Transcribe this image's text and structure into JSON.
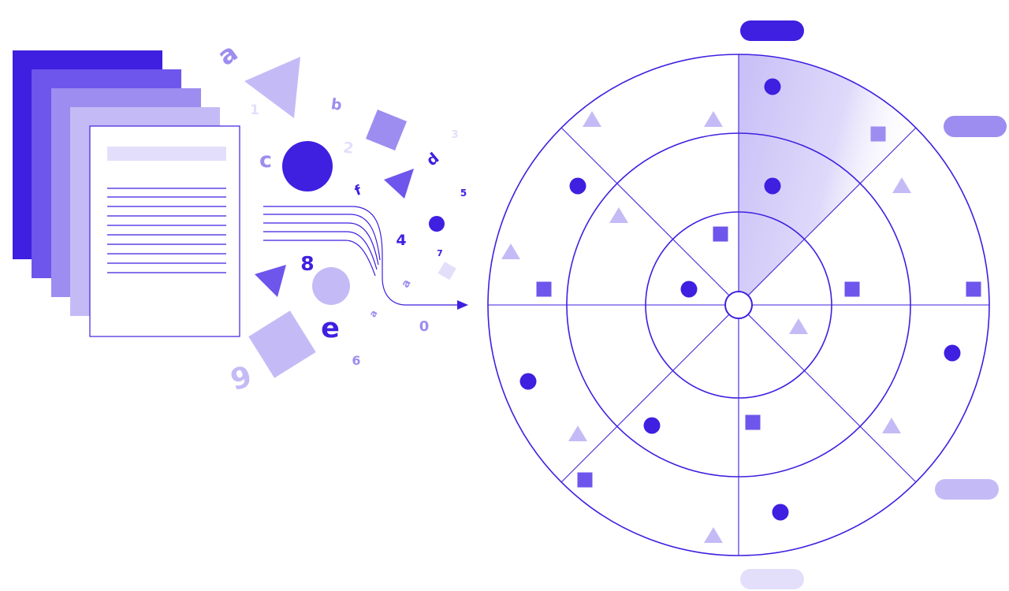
{
  "colors": {
    "primary": "#3f1fe0",
    "level_1": "#6e55ec",
    "level_2": "#9d8df0",
    "level_3": "#c4bbf6",
    "level_4": "#e3dffb",
    "background": "#ffffff"
  },
  "floating_glyphs": [
    {
      "text": "a",
      "tone": "level_2"
    },
    {
      "text": "1",
      "tone": "level_4"
    },
    {
      "text": "b",
      "tone": "level_2"
    },
    {
      "text": "c",
      "tone": "level_2"
    },
    {
      "text": "2",
      "tone": "level_4"
    },
    {
      "text": "3",
      "tone": "level_4"
    },
    {
      "text": "d",
      "tone": "primary"
    },
    {
      "text": "f",
      "tone": "primary"
    },
    {
      "text": "5",
      "tone": "primary"
    },
    {
      "text": "4",
      "tone": "primary"
    },
    {
      "text": "7",
      "tone": "primary"
    },
    {
      "text": "8",
      "tone": "primary"
    },
    {
      "text": "a",
      "tone": "level_2"
    },
    {
      "text": "a",
      "tone": "level_2"
    },
    {
      "text": "e",
      "tone": "primary"
    },
    {
      "text": "0",
      "tone": "level_2"
    },
    {
      "text": "6",
      "tone": "level_2"
    },
    {
      "text": "9",
      "tone": "level_3"
    }
  ],
  "radar_items": [
    {
      "shape": "circle",
      "tone": "primary"
    },
    {
      "shape": "circle",
      "tone": "primary"
    },
    {
      "shape": "square",
      "tone": "level_2"
    },
    {
      "shape": "square",
      "tone": "level_1"
    },
    {
      "shape": "triangle",
      "tone": "level_3"
    },
    {
      "shape": "triangle",
      "tone": "level_3"
    },
    {
      "shape": "circle",
      "tone": "primary"
    },
    {
      "shape": "triangle",
      "tone": "level_3"
    },
    {
      "shape": "triangle",
      "tone": "level_3"
    },
    {
      "shape": "triangle",
      "tone": "level_3"
    },
    {
      "shape": "square",
      "tone": "level_1"
    },
    {
      "shape": "circle",
      "tone": "primary"
    },
    {
      "shape": "square",
      "tone": "level_1"
    },
    {
      "shape": "square",
      "tone": "level_1"
    },
    {
      "shape": "circle",
      "tone": "primary"
    },
    {
      "shape": "triangle",
      "tone": "level_3"
    },
    {
      "shape": "circle",
      "tone": "primary"
    },
    {
      "shape": "circle",
      "tone": "primary"
    },
    {
      "shape": "square",
      "tone": "level_1"
    },
    {
      "shape": "triangle",
      "tone": "level_3"
    },
    {
      "shape": "triangle",
      "tone": "level_3"
    },
    {
      "shape": "square",
      "tone": "level_1"
    },
    {
      "shape": "circle",
      "tone": "primary"
    },
    {
      "shape": "triangle",
      "tone": "level_3"
    }
  ],
  "legend_pills": [
    {
      "tone": "primary"
    },
    {
      "tone": "level_2"
    },
    {
      "tone": "level_3"
    },
    {
      "tone": "level_4"
    }
  ]
}
